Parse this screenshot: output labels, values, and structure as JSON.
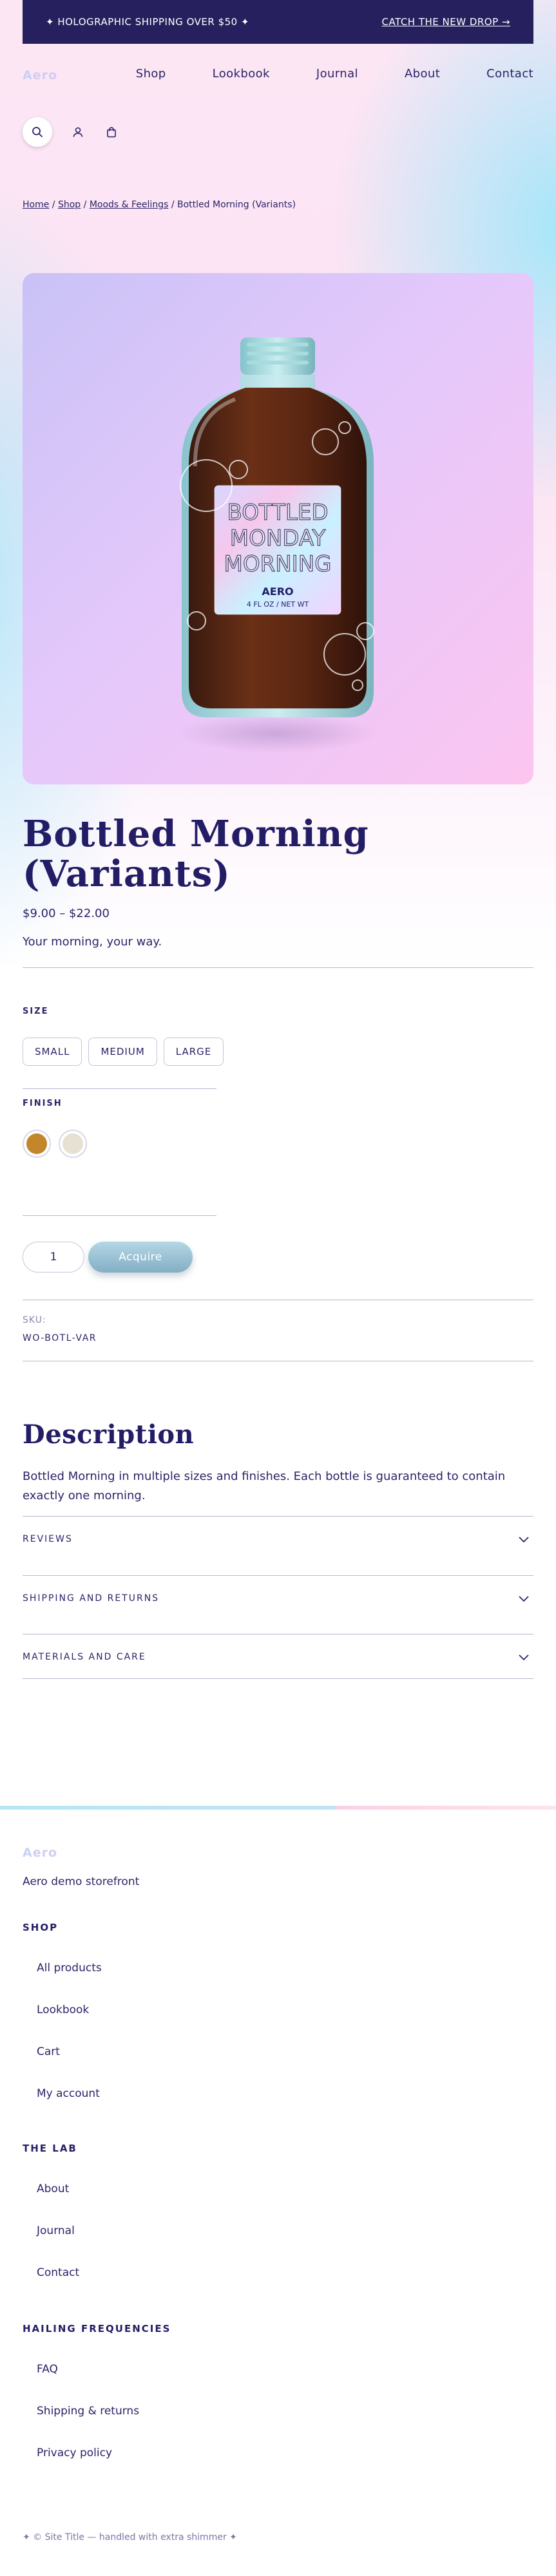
{
  "announcement": {
    "left": "✦ HOLOGRAPHIC SHIPPING OVER $50 ✦",
    "right": "CATCH THE NEW DROP →"
  },
  "brand": {
    "logo_text": "Aero"
  },
  "nav": {
    "items": [
      "Shop",
      "Lookbook",
      "Journal",
      "About",
      "Contact"
    ]
  },
  "icons": {
    "search": "search-icon",
    "account": "user-icon",
    "cart": "bag-icon"
  },
  "breadcrumb": {
    "home": "Home",
    "sep1": " / ",
    "shop": "Shop",
    "sep2": " / ",
    "category": "Moods & Feelings",
    "sep3": " / ",
    "current": "Bottled Morning (Variants)"
  },
  "hero": {
    "label_line1": "BOTTLED",
    "label_line2": "MONDAY",
    "label_line3": "MORNING",
    "label_brand": "AERO",
    "label_net": "4 FL OZ / NET WT"
  },
  "product": {
    "title": "Bottled Morning (Variants)",
    "price": "$9.00 – $22.00",
    "tagline": "Your morning, your way.",
    "size_label": "SIZE",
    "sizes": [
      "SMALL",
      "MEDIUM",
      "LARGE"
    ],
    "finish_label": "FINISH",
    "finish_colors": [
      "#c4862a",
      "#e7e1d4"
    ],
    "quantity": "1",
    "acquire_label": "Acquire",
    "sku_label": "SKU:",
    "sku_value": "WO-BOTL-VAR"
  },
  "description": {
    "heading": "Description",
    "text": "Bottled Morning in multiple sizes and finishes. Each bottle is guaranteed to contain exactly one morning."
  },
  "accordions": [
    "REVIEWS",
    "SHIPPING AND RETURNS",
    "MATERIALS AND CARE"
  ],
  "footer": {
    "tagline": "Aero demo storefront",
    "groups": [
      {
        "heading": "SHOP",
        "links": [
          "All products",
          "Lookbook",
          "Cart",
          "My account"
        ]
      },
      {
        "heading": "THE LAB",
        "links": [
          "About",
          "Journal",
          "Contact"
        ]
      },
      {
        "heading": "HAILING FREQUENCIES",
        "links": [
          "FAQ",
          "Shipping & returns",
          "Privacy policy"
        ]
      }
    ],
    "copyright": "✦ © Site Title — handled with extra shimmer ✦"
  },
  "colors": {
    "navy": "#26215e",
    "accent_button": "#9cc4d6",
    "border": "#c7c3da"
  }
}
